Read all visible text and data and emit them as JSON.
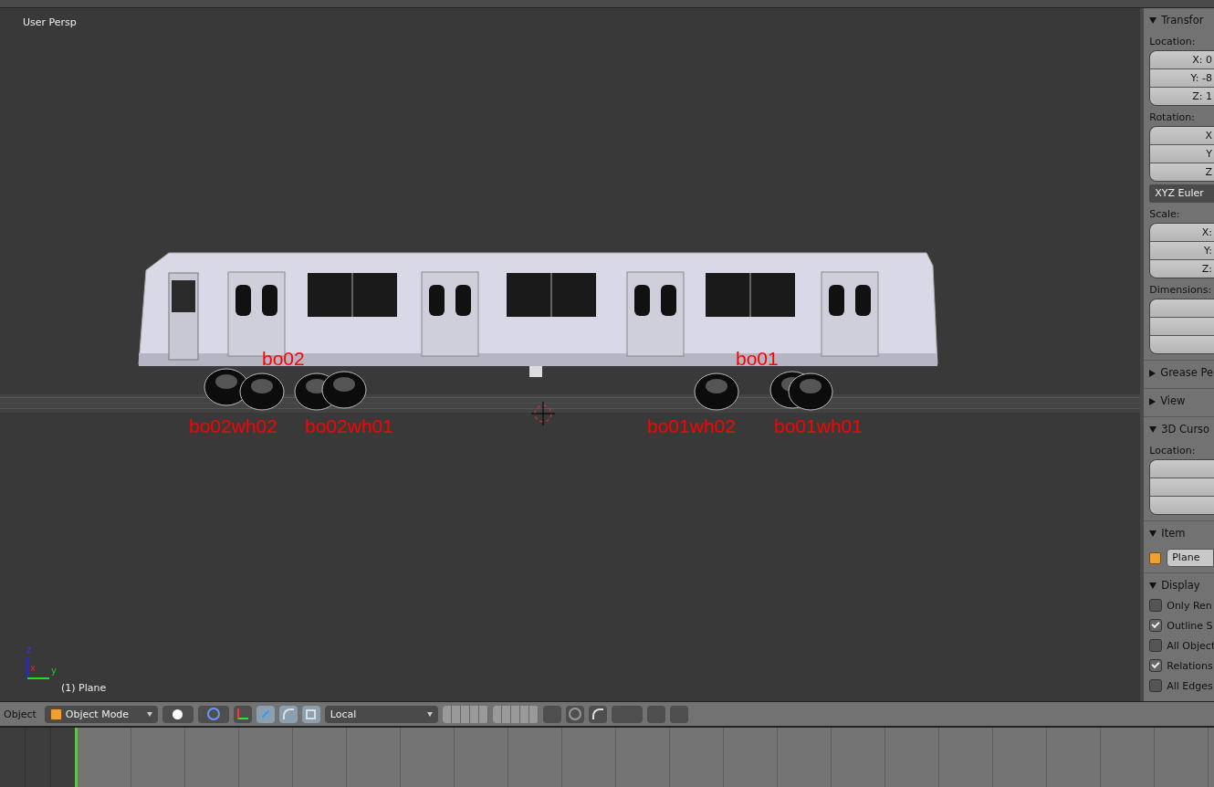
{
  "viewport": {
    "view_name": "User Persp",
    "object_label": "(1) Plane",
    "axes": [
      "z",
      "x",
      "y"
    ],
    "labels": [
      {
        "text": "bo02"
      },
      {
        "text": "bo01"
      },
      {
        "text": "bo02wh02"
      },
      {
        "text": "bo02wh01"
      },
      {
        "text": "bo01wh02"
      },
      {
        "text": "bo01wh01"
      }
    ]
  },
  "properties": {
    "panels": [
      {
        "kind": "transform",
        "title": "Transfor",
        "expanded": true,
        "location_label": "Location:",
        "location": [
          "X: 0",
          "Y: -8",
          "Z: 1"
        ],
        "rotation_label": "Rotation:",
        "rotation": [
          "X",
          "Y",
          "Z"
        ],
        "rotation_mode": "XYZ Euler",
        "scale_label": "Scale:",
        "scale": [
          "X:",
          "Y:",
          "Z:"
        ],
        "dimensions_label": "Dimensions:"
      },
      {
        "title": "Grease Pe",
        "expanded": false
      },
      {
        "title": "View",
        "expanded": false
      },
      {
        "kind": "cursor",
        "title": "3D Curso",
        "expanded": true,
        "location_label": "Location:"
      },
      {
        "kind": "item",
        "title": "Item",
        "expanded": true,
        "name": "Plane"
      },
      {
        "kind": "display",
        "title": "Display",
        "expanded": true,
        "options": [
          {
            "label": "Only Ren",
            "checked": false
          },
          {
            "label": "Outline S",
            "checked": true
          },
          {
            "label": "All Object",
            "checked": false
          },
          {
            "label": "Relations",
            "checked": true
          },
          {
            "label": "All Edges",
            "checked": false
          }
        ]
      }
    ]
  },
  "header": {
    "menu": "Object",
    "mode": "Object Mode",
    "orientation": "Local"
  }
}
